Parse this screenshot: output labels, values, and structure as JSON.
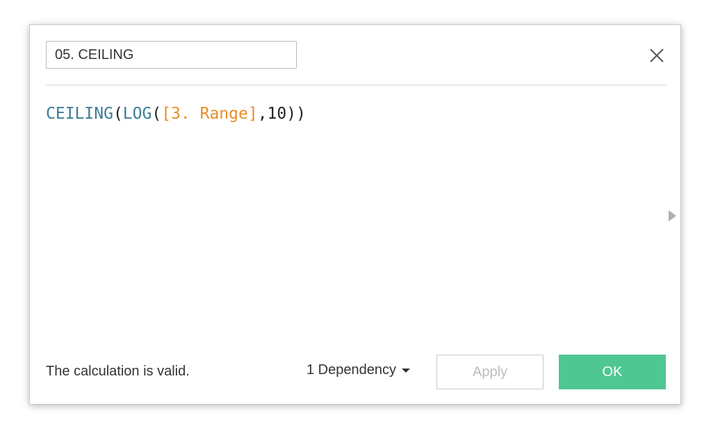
{
  "dialog": {
    "calc_name": "05. CEILING",
    "close_icon": "close-icon",
    "formula": {
      "fn1": "CEILING",
      "p1": "(",
      "fn2": "LOG",
      "p2": "(",
      "field": "[3. Range]",
      "comma": ",",
      "num": "10",
      "p3": "))"
    },
    "side_panel_icon": "expand-arrow-icon",
    "status": "The calculation is valid.",
    "dependency_label": "1 Dependency",
    "apply_label": "Apply",
    "ok_label": "OK"
  },
  "colors": {
    "function": "#3d7c96",
    "field": "#e58e2b",
    "ok_button": "#4fc792"
  }
}
